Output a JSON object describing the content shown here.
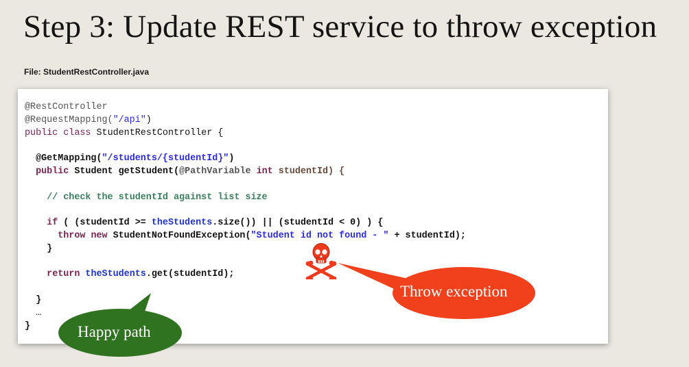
{
  "slide": {
    "title": "Step 3:  Update REST service to throw exception",
    "file_label": "File: StudentRestController.java"
  },
  "code": {
    "annotation_rest_controller": "@RestController",
    "annotation_request_mapping": "@RequestMapping(",
    "api_path": "\"/api\"",
    "close_paren": ")",
    "kw_public": "public",
    "kw_class": "class",
    "class_name": "StudentRestController {",
    "get_mapping": "@GetMapping(",
    "students_path": "\"/students/{studentId}\"",
    "return_type": "Student",
    "method_signature": "getStudent(",
    "path_variable": "@PathVariable",
    "kw_int": "int",
    "param_name": "studentId) {",
    "comment": "// check the studentId against list size",
    "kw_if": "if",
    "cond_open": " ( (studentId >= ",
    "field_name": "theStudents",
    "cond_rest": ".size()) || (studentId < 0) ) {",
    "kw_throw": "throw",
    "kw_new": "new",
    "exception_name": "StudentNotFoundException(",
    "exception_message": "\"Student id not found - \"",
    "exception_tail": " + studentId);",
    "close_brace": "}",
    "kw_return": "return",
    "return_tail": ".get(studentId);",
    "ellipsis": "…"
  },
  "callouts": {
    "throw_label": "Throw exception",
    "happy_label": "Happy path",
    "throw_color": "#f0401c",
    "happy_color": "#2f7321"
  },
  "icons": {
    "skull": "skull-crossbones-icon"
  }
}
